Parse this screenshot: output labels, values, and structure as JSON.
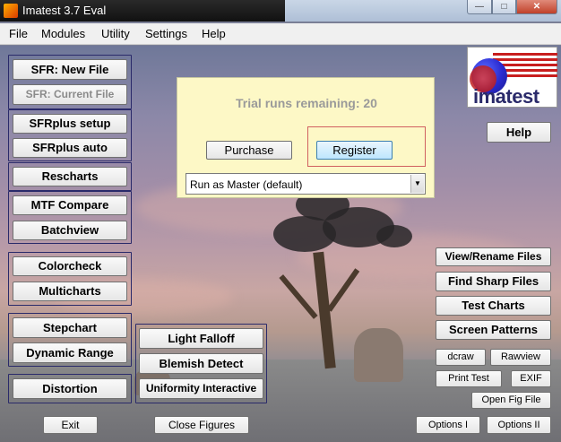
{
  "window": {
    "title": "Imatest 3.7  Eval",
    "min": "—",
    "max": "□",
    "close": "✕"
  },
  "menu": [
    "File",
    "Modules",
    "Utility",
    "Settings",
    "Help"
  ],
  "left_buttons": {
    "sfr_new": "SFR: New File",
    "sfr_current": "SFR: Current File",
    "sfrplus_setup": "SFRplus  setup",
    "sfrplus_auto": "SFRplus  auto",
    "rescharts": "Rescharts",
    "mtf_compare": "MTF Compare",
    "batchview": "Batchview",
    "colorcheck": "Colorcheck",
    "multicharts": "Multicharts",
    "stepchart": "Stepchart",
    "dynamic_range": "Dynamic Range",
    "distortion": "Distortion"
  },
  "middle_buttons": {
    "light_falloff": "Light Falloff",
    "blemish_detect": "Blemish Detect",
    "uniformity": "Uniformity Interactive"
  },
  "trial": {
    "message": "Trial runs remaining: 20",
    "purchase": "Purchase",
    "register": "Register",
    "run_mode": "Run as Master (default)"
  },
  "logo": {
    "word": "imatest",
    "icon": "imatest-logo"
  },
  "right_buttons": {
    "help": "Help",
    "view_rename": "View/Rename Files",
    "find_sharp": "Find Sharp Files",
    "test_charts": "Test Charts",
    "screen_patterns": "Screen Patterns",
    "dcraw": "dcraw",
    "rawview": "Rawview",
    "print_test": "Print Test",
    "exif": "EXIF",
    "open_fig": "Open Fig File",
    "options1": "Options I",
    "options2": "Options II"
  },
  "bottom_buttons": {
    "exit": "Exit",
    "close_figures": "Close Figures"
  }
}
